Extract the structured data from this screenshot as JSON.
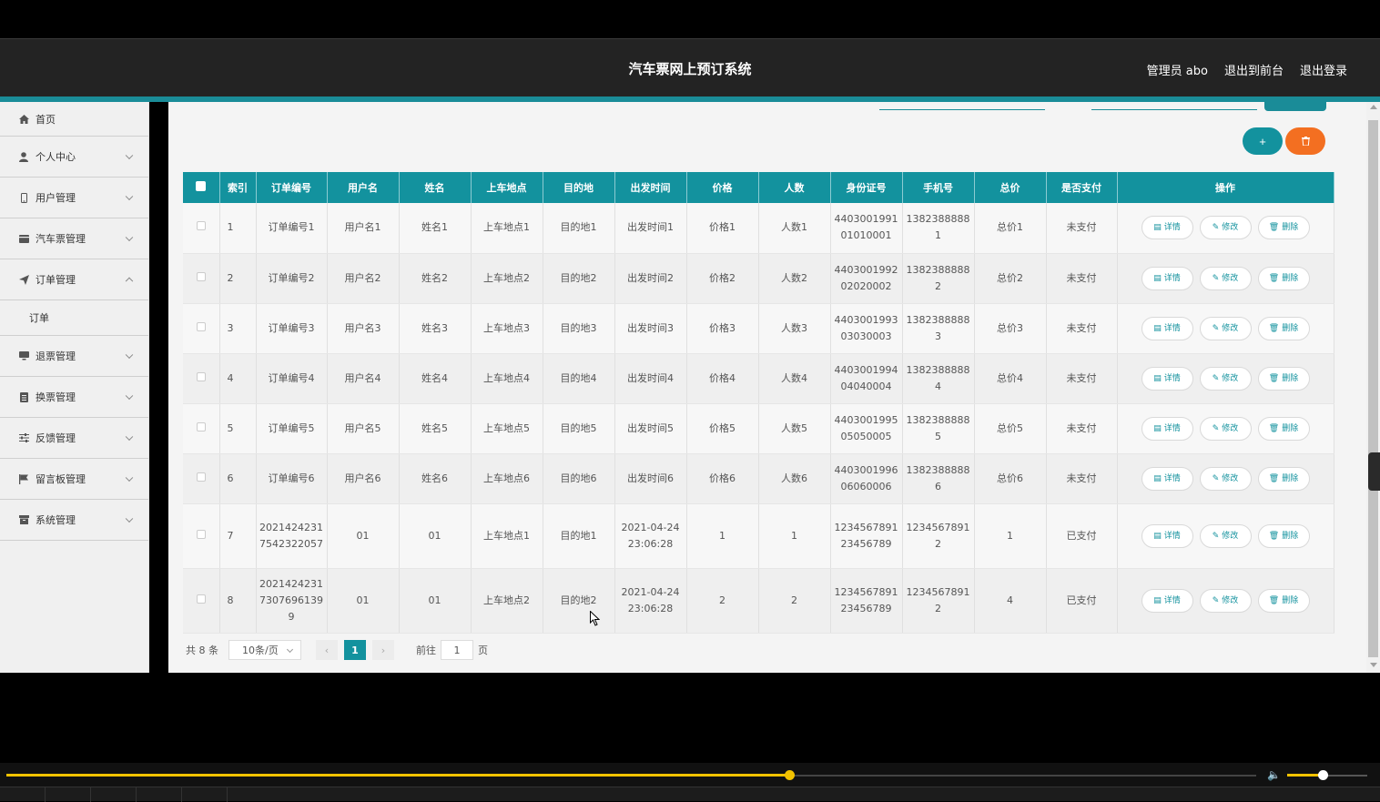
{
  "header": {
    "title": "汽车票网上预订系统",
    "admin": "管理员 abo",
    "front": "退出到前台",
    "logout": "退出登录"
  },
  "sidebar": {
    "items": [
      {
        "label": "首页",
        "icon": "home-icon"
      },
      {
        "label": "个人中心",
        "icon": "user-icon"
      },
      {
        "label": "用户管理",
        "icon": "phone-icon"
      },
      {
        "label": "汽车票管理",
        "icon": "card-icon"
      },
      {
        "label": "订单管理",
        "icon": "send-icon",
        "sub": "订单"
      },
      {
        "label": "退票管理",
        "icon": "monitor-icon"
      },
      {
        "label": "换票管理",
        "icon": "list-icon"
      },
      {
        "label": "反馈管理",
        "icon": "sliders-icon"
      },
      {
        "label": "留言板管理",
        "icon": "flag-icon"
      },
      {
        "label": "系统管理",
        "icon": "box-icon"
      }
    ]
  },
  "toolbar": {
    "add": "+",
    "delete": "🗑"
  },
  "table": {
    "headers": [
      "索引",
      "订单编号",
      "用户名",
      "姓名",
      "上车地点",
      "目的地",
      "出发时间",
      "价格",
      "人数",
      "身份证号",
      "手机号",
      "总价",
      "是否支付",
      "操作"
    ],
    "rows": [
      [
        "1",
        "订单编号1",
        "用户名1",
        "姓名1",
        "上车地点1",
        "目的地1",
        "出发时间1",
        "价格1",
        "人数1",
        "440300199101010001",
        "13823888881",
        "总价1",
        "未支付"
      ],
      [
        "2",
        "订单编号2",
        "用户名2",
        "姓名2",
        "上车地点2",
        "目的地2",
        "出发时间2",
        "价格2",
        "人数2",
        "440300199202020002",
        "13823888882",
        "总价2",
        "未支付"
      ],
      [
        "3",
        "订单编号3",
        "用户名3",
        "姓名3",
        "上车地点3",
        "目的地3",
        "出发时间3",
        "价格3",
        "人数3",
        "440300199303030003",
        "13823888883",
        "总价3",
        "未支付"
      ],
      [
        "4",
        "订单编号4",
        "用户名4",
        "姓名4",
        "上车地点4",
        "目的地4",
        "出发时间4",
        "价格4",
        "人数4",
        "440300199404040004",
        "13823888884",
        "总价4",
        "未支付"
      ],
      [
        "5",
        "订单编号5",
        "用户名5",
        "姓名5",
        "上车地点5",
        "目的地5",
        "出发时间5",
        "价格5",
        "人数5",
        "440300199505050005",
        "13823888885",
        "总价5",
        "未支付"
      ],
      [
        "6",
        "订单编号6",
        "用户名6",
        "姓名6",
        "上车地点6",
        "目的地6",
        "出发时间6",
        "价格6",
        "人数6",
        "440300199606060006",
        "13823888886",
        "总价6",
        "未支付"
      ],
      [
        "7",
        "20214242317542322057",
        "01",
        "01",
        "上车地点1",
        "目的地1",
        "2021-04-24 23:06:28",
        "1",
        "1",
        "123456789123456789",
        "12345678912",
        "1",
        "已支付"
      ],
      [
        "8",
        "202142423173076961399",
        "01",
        "01",
        "上车地点2",
        "目的地2",
        "2021-04-24 23:06:28",
        "2",
        "2",
        "123456789123456789",
        "12345678912",
        "4",
        "已支付"
      ]
    ],
    "actions": {
      "detail": "详情",
      "edit": "修改",
      "del": "删除"
    }
  },
  "pager": {
    "total": "共 8 条",
    "size": "10条/页",
    "current": "1",
    "goto": "前往",
    "goto_value": "1",
    "page": "页"
  },
  "player": {
    "progress": 0.6263,
    "volume": 0.44
  },
  "colors": {
    "accent": "#13929e",
    "orange": "#f36f21",
    "header": "#232323"
  }
}
